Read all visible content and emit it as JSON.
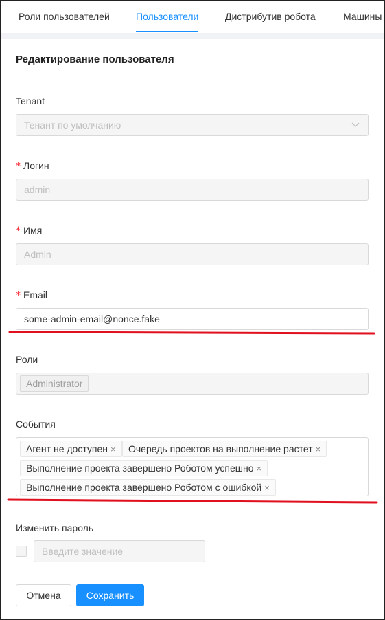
{
  "tabs": [
    {
      "label": "Роли пользователей",
      "active": false
    },
    {
      "label": "Пользователи",
      "active": true
    },
    {
      "label": "Дистрибутив робота",
      "active": false
    },
    {
      "label": "Машины",
      "active": false
    }
  ],
  "form": {
    "title": "Редактирование пользователя",
    "tenant": {
      "label": "Tenant",
      "value": "Тенант по умолчанию"
    },
    "login": {
      "label": "Логин",
      "value": "admin",
      "required": "*"
    },
    "name": {
      "label": "Имя",
      "value": "Admin",
      "required": "*"
    },
    "email": {
      "label": "Email",
      "value": "some-admin-email@nonce.fake",
      "required": "*"
    },
    "roles": {
      "label": "Роли",
      "tags": [
        "Administrator"
      ]
    },
    "events": {
      "label": "События",
      "tags": [
        "Агент не доступен",
        "Очередь проектов на выполнение растет",
        "Выполнение проекта завершено Роботом успешно",
        "Выполнение проекта завершено Роботом с ошибкой"
      ]
    },
    "password": {
      "label": "Изменить пароль",
      "placeholder": "Введите значение"
    }
  },
  "buttons": {
    "cancel": "Отмена",
    "save": "Сохранить"
  },
  "tag_close_glyph": "×",
  "colors": {
    "accent": "#1890ff",
    "required": "#f5222d",
    "annotation": "#e0101e"
  }
}
